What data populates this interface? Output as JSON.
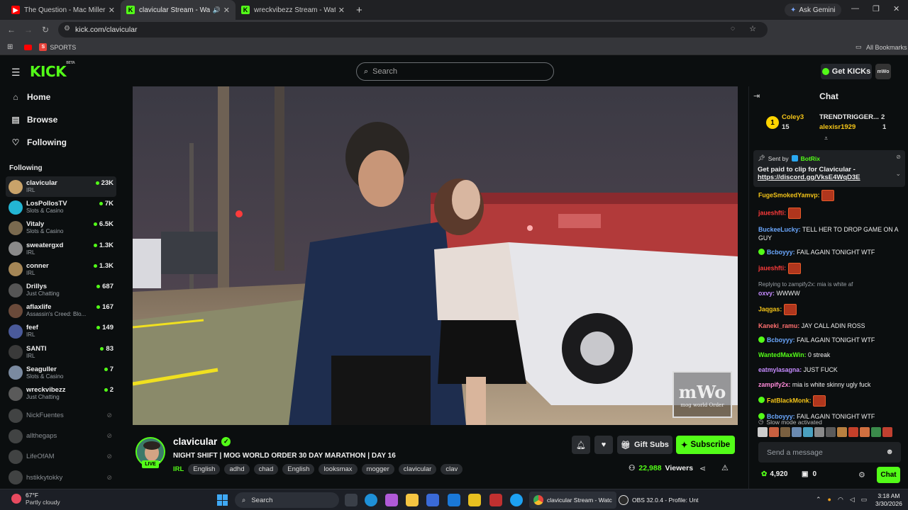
{
  "browser": {
    "tabs": [
      {
        "title": "The Question - Mac Miller ft. Li",
        "color": "#ff0000"
      },
      {
        "title": "clavicular Stream - Watch Li",
        "color": "#53fc18"
      },
      {
        "title": "wreckvibezz Stream - Watch Liv",
        "color": "#53fc18"
      }
    ],
    "ask_gemini": "Ask Gemini",
    "url": "kick.com/clavicular",
    "bookmarks": {
      "sports": "SPORTS",
      "all": "All Bookmarks"
    }
  },
  "kick": {
    "logo": "KICK",
    "logo_beta": "BETA",
    "search_placeholder": "Search",
    "get_kicks": "Get KICKs",
    "accent": "#53fc18"
  },
  "sidebar": {
    "nav": [
      {
        "label": "Home",
        "icon": "home-icon"
      },
      {
        "label": "Browse",
        "icon": "browse-icon"
      },
      {
        "label": "Following",
        "icon": "heart-icon"
      }
    ],
    "following_header": "Following",
    "following": [
      {
        "name": "clavicular",
        "category": "IRL",
        "viewers": "23K",
        "color": "#c9a36a"
      },
      {
        "name": "LosPollosTV",
        "category": "Slots & Casino",
        "viewers": "7K",
        "color": "#23b5d3"
      },
      {
        "name": "Vitaly",
        "category": "Slots & Casino",
        "viewers": "6.5K",
        "color": "#7a6a4f"
      },
      {
        "name": "sweatergxd",
        "category": "IRL",
        "viewers": "1.3K",
        "color": "#8a8a8a"
      },
      {
        "name": "conner",
        "category": "IRL",
        "viewers": "1.3K",
        "color": "#a48656"
      },
      {
        "name": "Drillys",
        "category": "Just Chatting",
        "viewers": "687",
        "color": "#555555"
      },
      {
        "name": "aflaxlife",
        "category": "Assassin's Creed: Blo...",
        "viewers": "167",
        "color": "#6a4a3a"
      },
      {
        "name": "feef",
        "category": "IRL",
        "viewers": "149",
        "color": "#4a5a9a"
      },
      {
        "name": "SANTI",
        "category": "IRL",
        "viewers": "83",
        "color": "#3a3a3a"
      },
      {
        "name": "Seaguller",
        "category": "Slots & Casino",
        "viewers": "7",
        "color": "#7a8aa0"
      },
      {
        "name": "wreckvibezz",
        "category": "Just Chatting",
        "viewers": "2",
        "color": "#5a5a5a"
      }
    ],
    "offline": [
      {
        "name": "NickFuentes"
      },
      {
        "name": "allthegaps"
      },
      {
        "name": "LifeOfAM"
      },
      {
        "name": "hstikkytokky"
      }
    ]
  },
  "video": {
    "watermark_main": "mWo",
    "watermark_sub": "mog world Order"
  },
  "stream": {
    "streamer": "clavicular",
    "live": "LIVE",
    "title": "NIGHT SHIFT | MOG WORLD ORDER 30 DAY MARATHON | DAY 16",
    "category": "IRL",
    "tags": [
      "English",
      "adhd",
      "chad",
      "English",
      "looksmax",
      "mogger",
      "clavicular",
      "clav"
    ],
    "gift_subs": "Gift Subs",
    "subscribe": "Subscribe",
    "viewers": "22,988",
    "viewers_label": "Viewers"
  },
  "chat": {
    "header": "Chat",
    "leaderboard": [
      {
        "rank": "1",
        "name": "Coley3",
        "count": "15"
      },
      {
        "name": "TRENDTRIGGER...",
        "count": "2"
      },
      {
        "name": "alexisr1929",
        "count": "1"
      }
    ],
    "pinned": {
      "sent_by_label": "Sent by",
      "sender": "BotRix",
      "text": "Get paid to clip for Clavicular -",
      "link": "https://discord.gg/VksE4WqD3E"
    },
    "messages": [
      {
        "user": "FugeSmokedYamvp:",
        "text": "",
        "color": "#f5c518",
        "emote": true
      },
      {
        "user": "jaueshfti:",
        "text": "",
        "color": "#ff3b3b",
        "emote": true
      },
      {
        "user": "BuckeeLucky:",
        "text": "TELL HER TO DROP GAME ON A GUY",
        "color": "#6ba8ff"
      },
      {
        "user": "Bcboyyy:",
        "text": "FAIL AGAIN TONIGHT WTF",
        "color": "#6ba8ff",
        "badge": true
      },
      {
        "user": "jaueshfti:",
        "text": "",
        "color": "#ff3b3b",
        "emote": true
      },
      {
        "reply": "Replying to zampify2x: mia is white af",
        "user": "oxvy:",
        "text": "WWWW",
        "color": "#c58bff"
      },
      {
        "user": "Jaqgas:",
        "text": "",
        "color": "#f5c518",
        "emote": true
      },
      {
        "user": "Kaneki_ramu:",
        "text": "JAY CALL ADIN ROSS",
        "color": "#ff6f6f"
      },
      {
        "user": "Bcboyyy:",
        "text": "FAIL AGAIN TONIGHT WTF",
        "color": "#6ba8ff",
        "badge": true
      },
      {
        "user": "WantedMaxWin:",
        "text": "0 streak",
        "color": "#53fc18"
      },
      {
        "user": "eatmylasagna:",
        "text": "JUST FUCK",
        "color": "#c58bff"
      },
      {
        "user": "zampify2x:",
        "text": "mia is white skinny ugly fuck",
        "color": "#ff8ad8"
      },
      {
        "user": "FatBlackMonk:",
        "text": "",
        "color": "#f5c518",
        "emote": true,
        "badge": true
      },
      {
        "user": "Bcboyyy:",
        "text": "FAIL AGAIN TONIGHT WTF",
        "color": "#6ba8ff",
        "badge": true
      }
    ],
    "slow_mode": "Slow mode activated",
    "input_placeholder": "Send a message",
    "points": "4,920",
    "drops": "0",
    "send": "Chat"
  },
  "taskbar": {
    "temp": "67°F",
    "weather": "Partly cloudy",
    "search": "Search",
    "windows": [
      {
        "title": "clavicular Stream - Watc"
      },
      {
        "title": "OBS 32.0.4 - Profile: Unt"
      }
    ],
    "time": "3:18 AM",
    "date": "3/30/2026"
  }
}
